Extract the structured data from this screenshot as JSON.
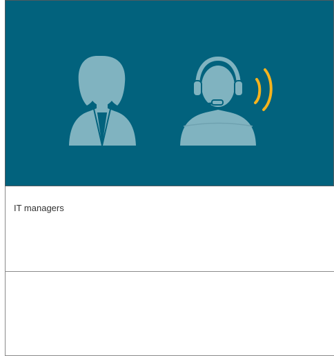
{
  "hero": {
    "background_color": "#02627d",
    "figure_color": "#80b3c0",
    "signal_color": "#f5b31d",
    "icons": [
      "user-woman-icon",
      "support-agent-headset-icon",
      "sound-waves-icon"
    ]
  },
  "rows": [
    {
      "label": "IT managers"
    },
    {
      "label": ""
    }
  ]
}
